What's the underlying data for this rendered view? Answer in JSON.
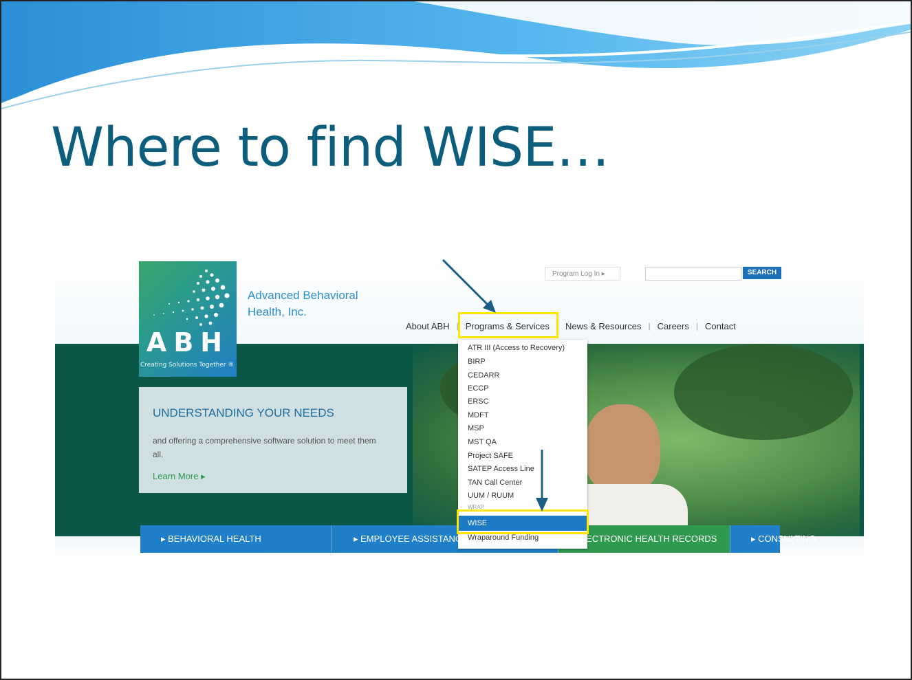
{
  "slide": {
    "title": "Where to find WISE…"
  },
  "site": {
    "logo_text": "ABH",
    "logo_tagline": "Creating Solutions Together ®",
    "brand_line1": "Advanced Behavioral",
    "brand_line2": "Health, Inc.",
    "program_login": "Program Log In ▸",
    "search_placeholder": "",
    "search_button": "SEARCH",
    "nav": [
      {
        "label": "About ABH"
      },
      {
        "label": "Programs & Services"
      },
      {
        "label": "News & Resources"
      },
      {
        "label": "Careers"
      },
      {
        "label": "Contact"
      }
    ],
    "hero": {
      "title": "UNDERSTANDING YOUR NEEDS",
      "text": "and offering a comprehensive software solution to meet them all.",
      "learn_more": "Learn More ▸"
    },
    "dropdown": [
      {
        "label": "ATR III (Access to Recovery)"
      },
      {
        "label": "BIRP"
      },
      {
        "label": "CEDARR"
      },
      {
        "label": "ECCP"
      },
      {
        "label": "ERSC"
      },
      {
        "label": "MDFT"
      },
      {
        "label": "MSP"
      },
      {
        "label": "MST QA"
      },
      {
        "label": "Project SAFE"
      },
      {
        "label": "SATEP Access Line"
      },
      {
        "label": "TAN Call Center"
      },
      {
        "label": "UUM / RUUM"
      },
      {
        "label": "WRAP"
      },
      {
        "label": "WISE"
      },
      {
        "label": "Wraparound Funding"
      }
    ],
    "bottom_nav": [
      {
        "label": "▸ BEHAVIORAL HEALTH",
        "color": "#1f7fc9"
      },
      {
        "label": "▸ EMPLOYEE ASSISTANCE PROGRAMS",
        "color": "#1f7fc9"
      },
      {
        "label": "▸ ELECTRONIC HEALTH RECORDS",
        "color": "#2f9a4e"
      },
      {
        "label": "▸ CONSULTING",
        "color": "#1f7fc9"
      }
    ]
  },
  "colors": {
    "title": "#0d5e7d",
    "highlight": "#ffe600",
    "arrow": "#1b5f86"
  }
}
